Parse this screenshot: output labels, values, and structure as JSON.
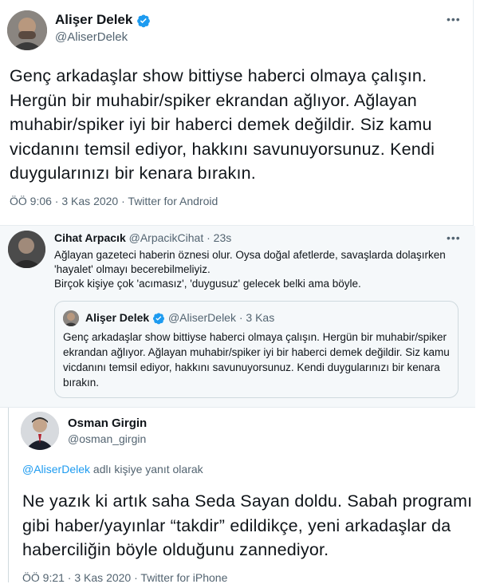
{
  "tweet1": {
    "name": "Alişer Delek",
    "handle": "@AliserDelek",
    "text": "Genç arkadaşlar show bittiyse haberci olmaya çalışın. Hergün bir muhabir/spiker  ekrandan ağlıyor. Ağlayan muhabir/spiker iyi bir haberci demek değildir. Siz kamu vicdanını temsil ediyor, hakkını savunuyorsunuz. Kendi duygularınızı bir kenara bırakın.",
    "time": "ÖÖ 9:06",
    "date": "3 Kas 2020",
    "source": "Twitter for Android",
    "more_icon": "more-dots-icon"
  },
  "tweet2": {
    "name": "Cihat Arpacık",
    "handle": "@ArpacikCihat",
    "age": "23s",
    "line1": "Ağlayan gazeteci haberin öznesi olur. Oysa doğal afetlerde, savaşlarda dolaşırken 'hayalet' olmayı becerebilmeliyiz.",
    "line2": "Birçok kişiye çok 'acımasız', 'duygusuz' gelecek belki ama böyle.",
    "quote": {
      "name": "Alişer Delek",
      "handle": "@AliserDelek",
      "date": "3 Kas",
      "text": "Genç arkadaşlar show bittiyse haberci olmaya çalışın. Hergün bir muhabir/spiker  ekrandan ağlıyor. Ağlayan muhabir/spiker iyi bir haberci demek değildir. Siz kamu vicdanını temsil ediyor, hakkını savunuyorsunuz. Kendi duygularınızı bir kenara bırakın."
    }
  },
  "tweet3": {
    "name": "Osman Girgin",
    "handle": "@osman_girgin",
    "reply_handle": "@AliserDelek",
    "reply_suffix": "adlı kişiye yanıt olarak",
    "text": "Ne yazık ki artık saha Seda Sayan doldu. Sabah programı gibi haber/yayınlar “takdir” edildikçe, yeni arkadaşlar da haberciliğin böyle olduğunu zannediyor.",
    "time": "ÖÖ 9:21",
    "date": "3 Kas 2020",
    "source": "Twitter for iPhone"
  },
  "colors": {
    "accent": "#1d9bf0",
    "muted": "#536471",
    "border": "#cfd9de",
    "quote_bg": "#f5f8fa"
  }
}
